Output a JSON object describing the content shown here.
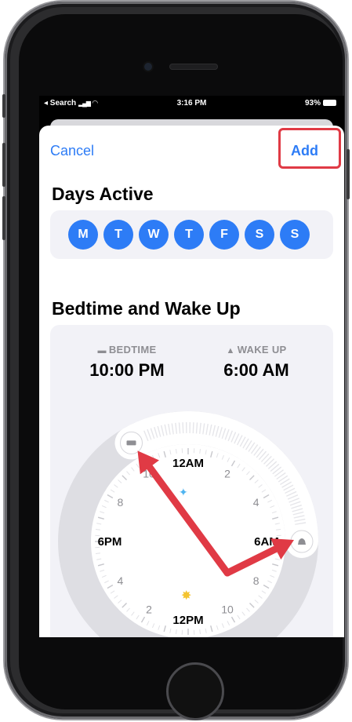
{
  "status_bar": {
    "left": "◂ Search",
    "time": "3:16 PM",
    "battery": "93%"
  },
  "nav": {
    "cancel": "Cancel",
    "add": "Add"
  },
  "days_active": {
    "title": "Days Active",
    "days": [
      "M",
      "T",
      "W",
      "T",
      "F",
      "S",
      "S"
    ],
    "accent_color": "#2d7cf6"
  },
  "bedtime_wake": {
    "title": "Bedtime and Wake Up",
    "bedtime_label": "BEDTIME",
    "bedtime_time": "10:00 PM",
    "wake_label": "WAKE UP",
    "wake_time": "6:00 AM",
    "bedtime_icon": "bed-icon",
    "wake_icon": "bell-icon"
  },
  "clock": {
    "numbers": [
      "12AM",
      "2",
      "4",
      "6AM",
      "8",
      "10",
      "12PM",
      "2",
      "4",
      "6PM",
      "8",
      "10"
    ],
    "sleep_start_hour": 22,
    "sleep_end_hour": 6,
    "annotation_color": "#e03a45"
  }
}
